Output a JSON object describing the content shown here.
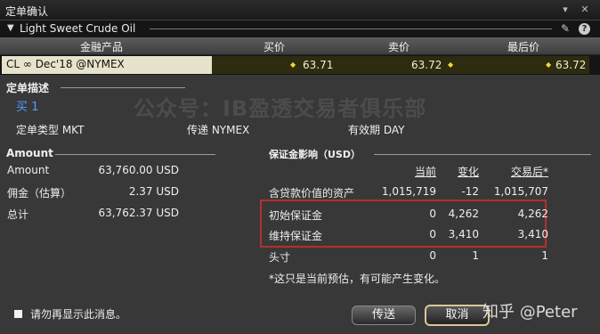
{
  "window": {
    "title": "定单确认",
    "pin_glyph": "▾",
    "close_glyph": "✕"
  },
  "instrument": {
    "name": "Light Sweet Crude Oil",
    "help_glyph": "?"
  },
  "quote": {
    "headers": {
      "product": "金融产品",
      "bid": "买价",
      "ask": "卖价",
      "last": "最后价"
    },
    "symbol": "CL ∞ Dec'18 @NYMEX",
    "bid": "63.71",
    "ask": "63.72",
    "last": "63.72"
  },
  "order_desc": {
    "section_title": "定单描述",
    "action": "买 1",
    "type_label": "定单类型 MKT",
    "route_label": "传递 NYMEX",
    "tif_label": "有效期 DAY"
  },
  "watermark": "公众号：IB盈透交易者俱乐部",
  "amount": {
    "section_title": "Amount",
    "rows": [
      {
        "label": "Amount",
        "value": "63,760.00 USD"
      },
      {
        "label": "佣金（估算）",
        "value": "2.37 USD"
      },
      {
        "label": "总计",
        "value": "63,762.37 USD"
      }
    ]
  },
  "margin": {
    "section_title": "保证金影响（USD）",
    "headers": {
      "current": "当前",
      "change": "变化",
      "after": "交易后*"
    },
    "rows": [
      {
        "label": "含贷款价值的资产",
        "current": "1,015,719",
        "change": "-12",
        "after": "1,015,707"
      },
      {
        "label": "初始保证金",
        "current": "0",
        "change": "4,262",
        "after": "4,262"
      },
      {
        "label": "维持保证金",
        "current": "0",
        "change": "3,410",
        "after": "3,410"
      },
      {
        "label": "头寸",
        "current": "0",
        "change": "1",
        "after": "1"
      }
    ],
    "footnote": "*这只是当前预估，有可能产生变化。"
  },
  "footer": {
    "dont_show_label": "请勿再显示此消息。",
    "transmit_label": "传送",
    "cancel_label": "取消"
  },
  "overlay_brand": "知乎 @Peter"
}
